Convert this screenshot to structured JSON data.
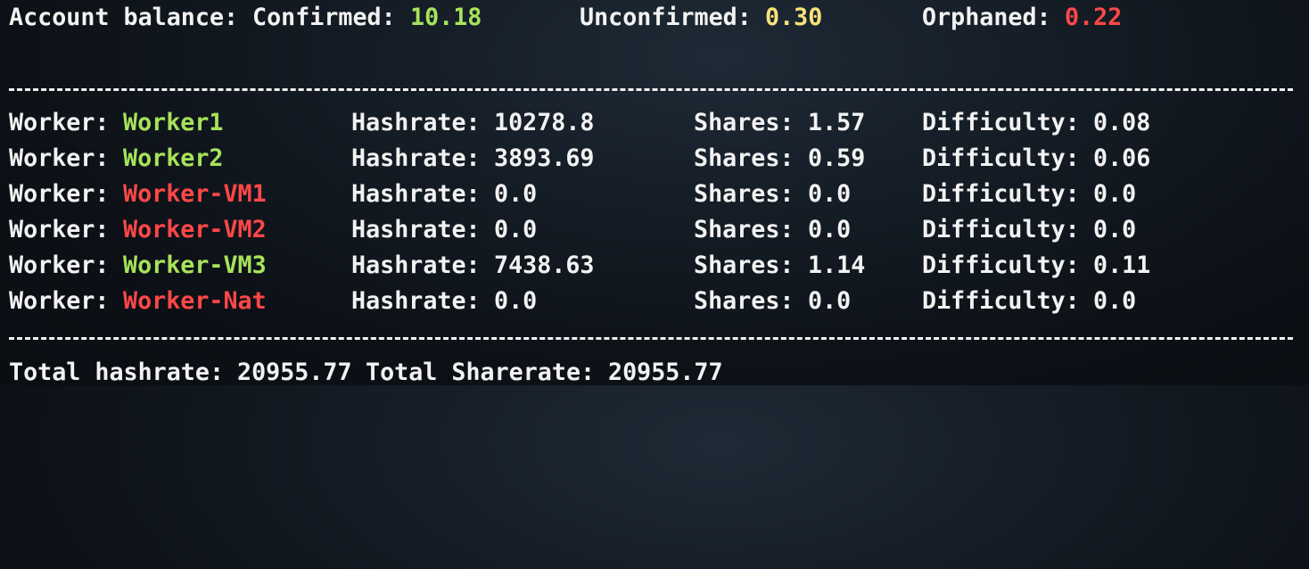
{
  "balance": {
    "prefix": "Account balance:",
    "confirmed_label": "Confirmed:",
    "confirmed_value": "10.18",
    "unconfirmed_label": "Unconfirmed:",
    "unconfirmed_value": "0.30",
    "orphaned_label": "Orphaned:",
    "orphaned_value": "0.22"
  },
  "labels": {
    "worker": "Worker:",
    "hashrate": "Hashrate:",
    "shares": "Shares:",
    "difficulty": "Difficulty:"
  },
  "workers": [
    {
      "name": "Worker1",
      "status": "active",
      "hashrate": "10278.8",
      "shares": "1.57",
      "difficulty": "0.08"
    },
    {
      "name": "Worker2",
      "status": "active",
      "hashrate": "3893.69",
      "shares": "0.59",
      "difficulty": "0.06"
    },
    {
      "name": "Worker-VM1",
      "status": "inactive",
      "hashrate": "0.0",
      "shares": "0.0",
      "difficulty": "0.0"
    },
    {
      "name": "Worker-VM2",
      "status": "inactive",
      "hashrate": "0.0",
      "shares": "0.0",
      "difficulty": "0.0"
    },
    {
      "name": "Worker-VM3",
      "status": "active",
      "hashrate": "7438.63",
      "shares": "1.14",
      "difficulty": "0.11"
    },
    {
      "name": "Worker-Nat",
      "status": "inactive",
      "hashrate": "0.0",
      "shares": "0.0",
      "difficulty": "0.0"
    }
  ],
  "totals": {
    "hashrate_label": "Total hashrate:",
    "hashrate_value": "20955.77",
    "sharerate_label": "Total Sharerate:",
    "sharerate_value": "20955.77"
  },
  "colors": {
    "active": "#a6e35a",
    "inactive": "#ff4747",
    "confirmed": "#a6e35a",
    "unconfirmed": "#f6e27a",
    "orphaned": "#ff4747",
    "text": "#f2f2f2",
    "background": "#0d1117"
  }
}
